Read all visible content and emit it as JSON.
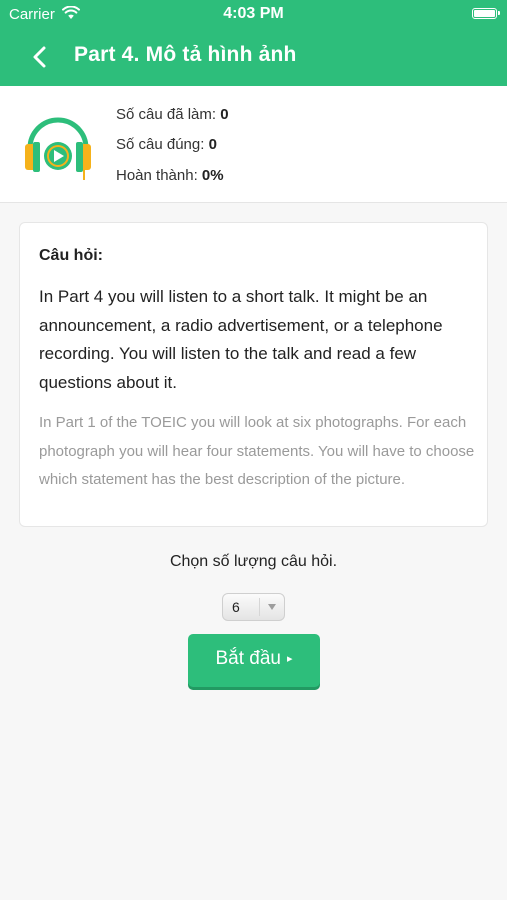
{
  "status_bar": {
    "carrier": "Carrier",
    "time": "4:03 PM",
    "wifi_icon": "wifi-icon",
    "battery_icon": "battery-icon"
  },
  "nav": {
    "back_icon": "chevron-left-icon",
    "title": "Part 4. Mô tả hình ảnh",
    "color": "#2dbe7b"
  },
  "stats": {
    "icon": "headphones-play-icon",
    "done_label": "Số câu đã làm:",
    "done_value": "0",
    "correct_label": "Số câu đúng:",
    "correct_value": "0",
    "complete_label": "Hoàn thành:",
    "complete_value": "0%"
  },
  "question": {
    "label": "Câu hỏi:",
    "main_text": "In Part 4 you will listen to a short talk. It might be an announcement, a radio advertisement, or a telephone recording. You will listen to the talk and read a few questions about it.",
    "sub_text": "In Part 1 of the TOEIC you will look at six photographs. For each photograph you will hear four statements. You will have to choose which statement has the best description of the picture."
  },
  "selection": {
    "prompt": "Chọn số lượng câu hỏi.",
    "selected_value": "6"
  },
  "start_button": {
    "label": "Bắt đầu",
    "glyph": "▸",
    "color": "#2dbe7b"
  }
}
